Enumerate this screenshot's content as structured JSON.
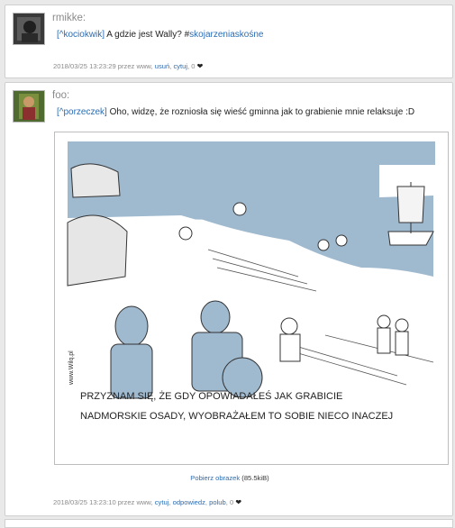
{
  "posts": [
    {
      "username": "rmikke:",
      "ref_user": "[^kociokwik]",
      "text": " A gdzie jest Wally? #",
      "hashtag": "skojarzeniaskośne",
      "meta_prefix": "2018/03/25 13:23:29 przez www,",
      "actions": [
        "usuń",
        "cytuj",
        "0"
      ]
    },
    {
      "username": "foo:",
      "ref_user": "[^porzeczek]",
      "text": " Oho, widzę, że rozniosła się wieść gminna jak to grabienie mnie relaksuje :D",
      "image": {
        "caption_line1": "PRZYZNAM SIĘ, ŻE GDY OPOWIADAŁEŚ JAK GRABICIE",
        "caption_line2": "NADMORSKIE OSADY, WYOBRAŻAŁEM TO SOBIE NIECO INACZEJ",
        "signature": "www.Wilq.pl"
      },
      "download_label": "Pobierz obrazek",
      "download_size": "(85.5kiB)",
      "meta_prefix": "2018/03/25 13:23:10 przez www,",
      "actions": [
        "cytuj",
        "odpowiedz",
        "polub",
        "0"
      ]
    }
  ],
  "colors": {
    "link": "#2b6cb3",
    "sea": "#9fb9cf"
  }
}
